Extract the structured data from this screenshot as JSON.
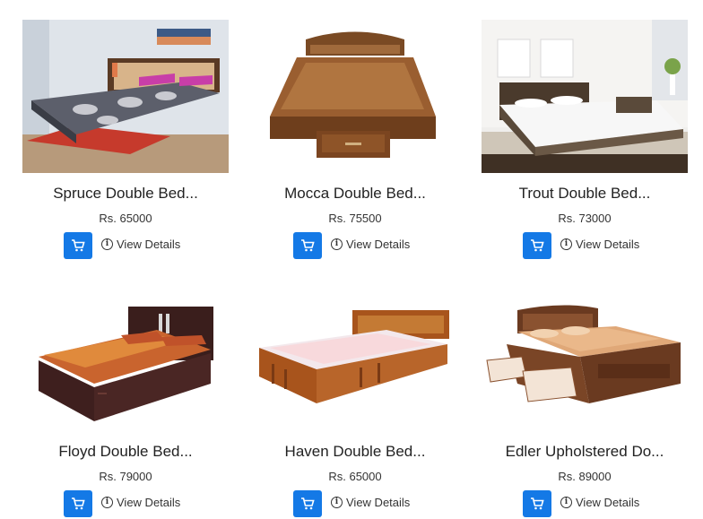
{
  "products": [
    {
      "title": "Spruce Double Bed...",
      "price": "Rs. 65000",
      "details_label": "View Details",
      "cart_icon": "cart-icon",
      "info_icon": "info-icon"
    },
    {
      "title": "Mocca Double Bed...",
      "price": "Rs. 75500",
      "details_label": "View Details",
      "cart_icon": "cart-icon",
      "info_icon": "info-icon"
    },
    {
      "title": "Trout Double Bed...",
      "price": "Rs. 73000",
      "details_label": "View Details",
      "cart_icon": "cart-icon",
      "info_icon": "info-icon"
    },
    {
      "title": "Floyd Double Bed...",
      "price": "Rs. 79000",
      "details_label": "View Details",
      "cart_icon": "cart-icon",
      "info_icon": "info-icon"
    },
    {
      "title": "Haven Double Bed...",
      "price": "Rs. 65000",
      "details_label": "View Details",
      "cart_icon": "cart-icon",
      "info_icon": "info-icon"
    },
    {
      "title": "Edler Upholstered Do...",
      "price": "Rs. 89000",
      "details_label": "View Details",
      "cart_icon": "cart-icon",
      "info_icon": "info-icon"
    }
  ],
  "colors": {
    "cart_button": "#1479e6",
    "text": "#333333",
    "background": "#ffffff"
  }
}
